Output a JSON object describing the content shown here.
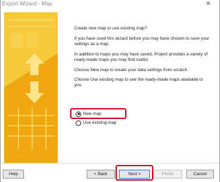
{
  "window": {
    "title": "Export Wizard - Map",
    "close_glyph": "✕"
  },
  "main": {
    "paragraphs": [
      "Create new map or use existing map?",
      "If you have used this wizard before you may have chosen to save your settings as a map.",
      "In addition to maps you may have saved, Project provides a variety of ready-made maps you may find useful.",
      "Choose New map to create your data settings from scratch.",
      "Choose Use existing map to see the ready-made maps available to you."
    ],
    "options": [
      {
        "label": "New map",
        "selected": true
      },
      {
        "label": "Use existing map",
        "selected": false
      }
    ]
  },
  "buttons": {
    "help": "Help",
    "back": "< Back",
    "next": "Next >",
    "finish": "Finish",
    "cancel": "Cancel"
  },
  "colors": {
    "banner": "#f4b81c",
    "highlight": "#d0102a"
  }
}
